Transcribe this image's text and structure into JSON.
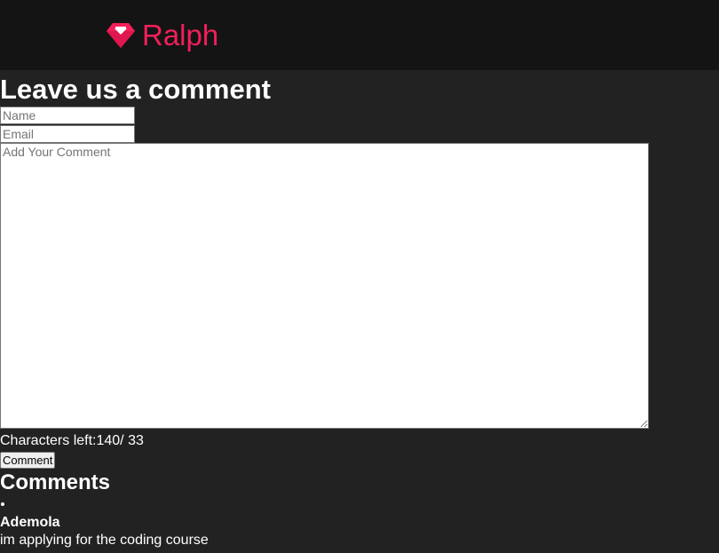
{
  "header": {
    "logo_text": "Ralph",
    "logo_icon": "gem-icon",
    "brand_color": "#f21f5a"
  },
  "form": {
    "title": "Leave us a comment",
    "name_placeholder": "Name",
    "email_placeholder": "Email",
    "comment_placeholder": "Add Your Comment",
    "char_counter": "Characters left:140/ 33",
    "submit_label": "Comment"
  },
  "comments": {
    "heading": "Comments",
    "items": [
      {
        "author": "Ademola",
        "text": "im applying for the coding course"
      }
    ]
  }
}
